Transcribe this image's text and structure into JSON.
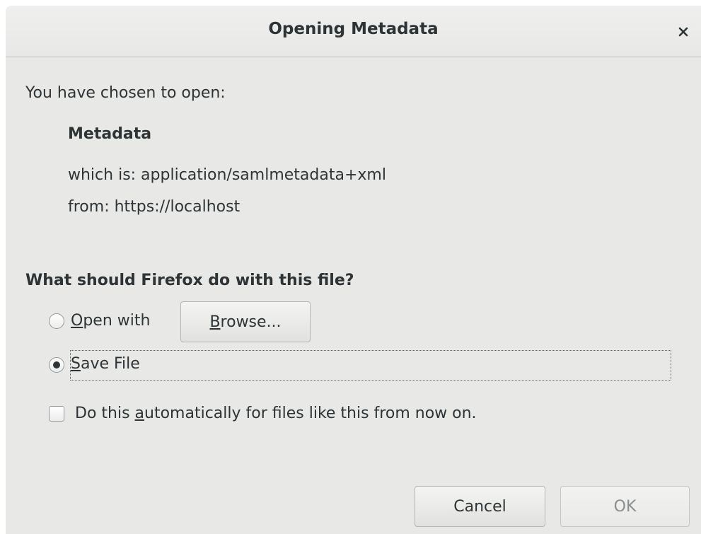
{
  "dialog": {
    "title": "Opening Metadata",
    "close_symbol": "×"
  },
  "info": {
    "intro": "You have chosen to open:",
    "filename": "Metadata",
    "type_line": "which is: application/samlmetadata+xml",
    "from_line": "from: https://localhost"
  },
  "question": "What should Firefox do with this file?",
  "options": {
    "open_with": {
      "mnemonic": "O",
      "rest": "pen with",
      "selected": false
    },
    "browse_button": {
      "mnemonic": "B",
      "rest": "rowse..."
    },
    "save_file": {
      "mnemonic": "S",
      "rest": "ave File",
      "selected": true
    },
    "auto": {
      "before": "Do this ",
      "mnemonic": "a",
      "after": "utomatically for files like this from now on.",
      "checked": false
    }
  },
  "buttons": {
    "cancel": "Cancel",
    "ok": "OK"
  }
}
